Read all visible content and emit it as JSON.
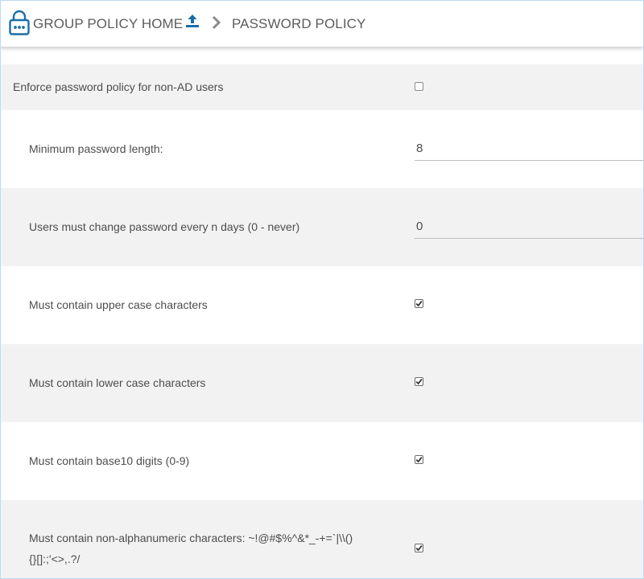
{
  "header": {
    "home_label": "GROUP POLICY HOME",
    "current_label": "PASSWORD POLICY",
    "accent_color": "#1a6ea8"
  },
  "policy": {
    "enforce_label": "Enforce password policy for non-AD users",
    "enforce_checked": false,
    "min_length_label": "Minimum password length:",
    "min_length_value": "8",
    "change_days_label": "Users must change password every n days (0 - never)",
    "change_days_value": "0",
    "upper_label": "Must contain upper case characters",
    "upper_checked": true,
    "lower_label": "Must contain lower case characters",
    "lower_checked": true,
    "digits_label": "Must contain base10 digits (0-9)",
    "digits_checked": true,
    "special_label_line1": "Must contain non-alphanumeric characters: ~!@#$%^&*_-+=`|\\\\()",
    "special_label_line2": "{}[]:;'<>,.?/",
    "special_checked": true
  }
}
